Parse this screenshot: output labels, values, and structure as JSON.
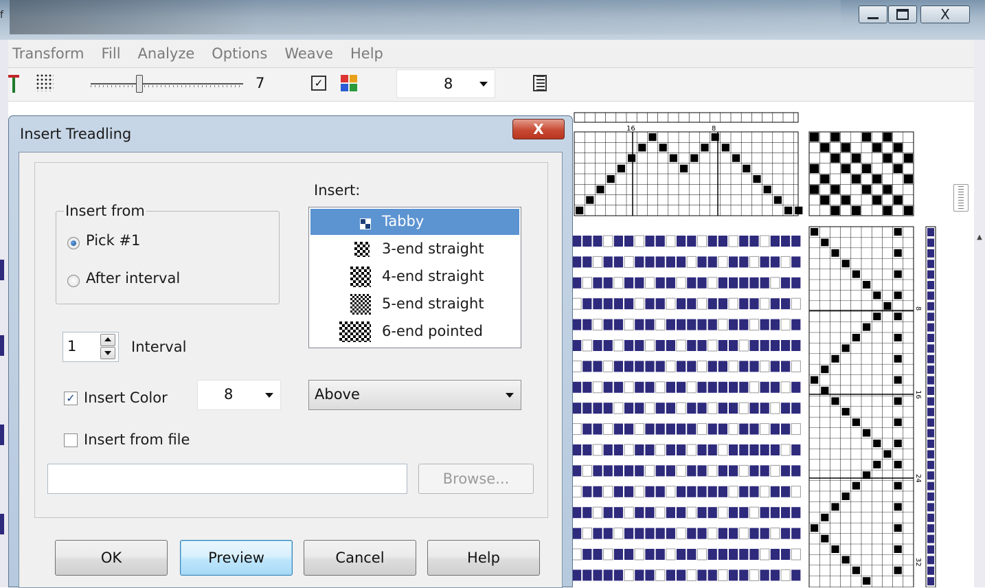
{
  "window": {
    "title_partial": "f",
    "controls": {
      "minimize": "▭",
      "maximize": "▣",
      "close": "X"
    }
  },
  "menubar": {
    "items": [
      "Transform",
      "Fill",
      "Analyze",
      "Options",
      "Weave",
      "Help"
    ]
  },
  "toolbar": {
    "slider_value": "7",
    "color_count": "8"
  },
  "draft": {
    "threading_labels": [
      "16",
      "8"
    ],
    "treadling_labels": [
      "8",
      "16",
      "24",
      "32"
    ],
    "colors": {
      "thread": "#2e2a7c",
      "grid": "#000000"
    }
  },
  "dialog": {
    "title": "Insert Treadling",
    "close_label": "X",
    "insert_from": {
      "legend": "Insert from",
      "options": [
        {
          "label": "Pick #1",
          "selected": true
        },
        {
          "label": "After interval",
          "selected": false
        }
      ]
    },
    "interval": {
      "value": "1",
      "label": "Interval"
    },
    "insert_color": {
      "label": "Insert Color",
      "checked": true,
      "value": "8"
    },
    "insert_from_file": {
      "label": "Insert from file",
      "checked": false
    },
    "file_path": "",
    "browse_label": "Browse...",
    "insert": {
      "label": "Insert:",
      "items": [
        {
          "label": "Tabby",
          "selected": true
        },
        {
          "label": "3-end straight",
          "selected": false
        },
        {
          "label": "4-end straight",
          "selected": false
        },
        {
          "label": "5-end straight",
          "selected": false
        },
        {
          "label": "6-end pointed",
          "selected": false
        }
      ]
    },
    "position": {
      "value": "Above"
    },
    "buttons": {
      "ok": "OK",
      "preview": "Preview",
      "cancel": "Cancel",
      "help": "Help"
    }
  }
}
